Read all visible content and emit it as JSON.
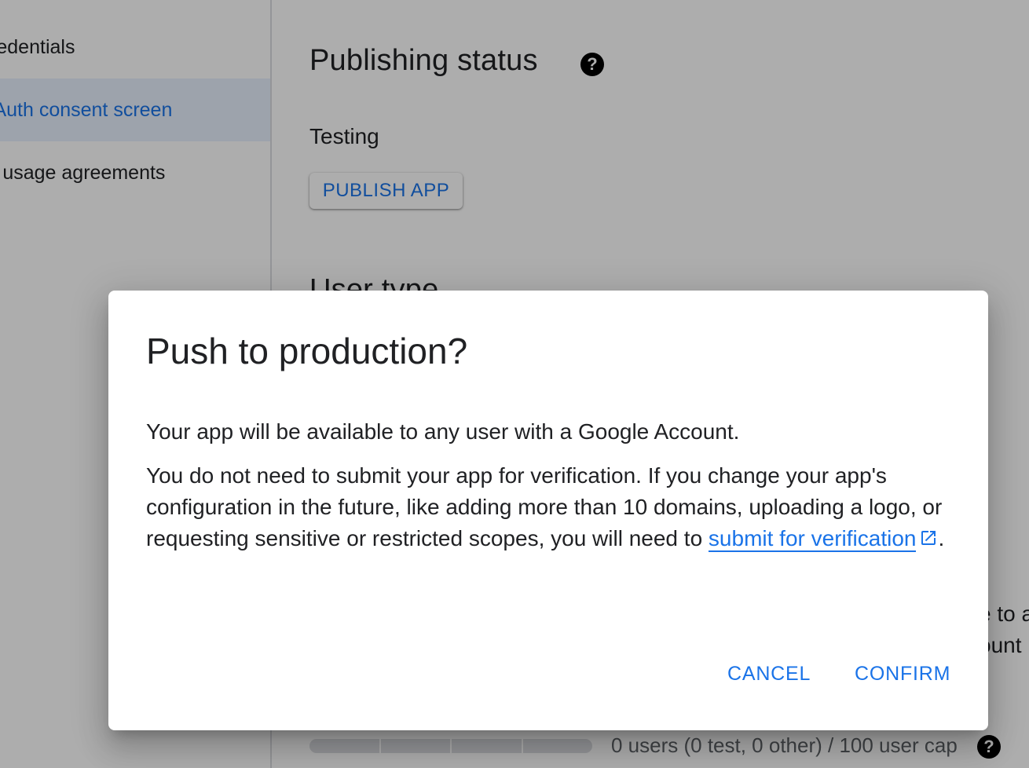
{
  "sidebar": {
    "items": [
      {
        "label": "Credentials"
      },
      {
        "label": "OAuth consent screen",
        "active": true
      },
      {
        "label": "Page usage agreements"
      }
    ]
  },
  "main": {
    "publishing_status": {
      "title": "Publishing status",
      "status": "Testing",
      "publish_button": "PUBLISH APP"
    },
    "user_type": {
      "title": "User type"
    },
    "partial_text": {
      "line1": "e to a",
      "line2": "ount"
    },
    "user_cap": {
      "text": "0 users (0 test, 0 other) / 100 user cap",
      "progress": 0
    }
  },
  "dialog": {
    "title": "Push to production?",
    "paragraph1": "Your app will be available to any user with a Google Account.",
    "paragraph2_text": "You do not need to submit your app for verification. If you change your app's configuration in the future, like adding more than 10 domains, uploading a logo, or requesting sensitive or restricted scopes, you will need to ",
    "paragraph2_link": "submit for verification",
    "paragraph2_end": ".",
    "cancel_label": "CANCEL",
    "confirm_label": "CONFIRM"
  },
  "icons": {
    "help": "help-circle-icon",
    "external_link": "open-in-new-icon"
  },
  "colors": {
    "accent": "#1a73e8",
    "active_nav_bg": "#e8f0fe",
    "text": "#202124",
    "scrim": "rgba(0,0,0,0.32)"
  }
}
